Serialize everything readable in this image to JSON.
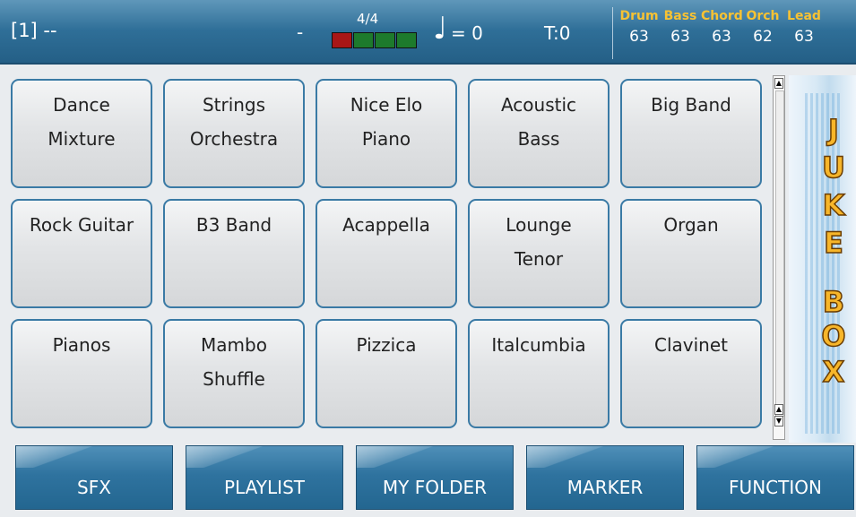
{
  "header": {
    "song": "[1] --",
    "dash": "-",
    "time_signature": "4/4",
    "beats": [
      "#a81616",
      "#1d7a2c",
      "#1d7a2c",
      "#1d7a2c"
    ],
    "tempo_note": "♩",
    "tempo": "= 0",
    "transpose": "T:0",
    "parts": [
      {
        "name": "Drum",
        "value": "63"
      },
      {
        "name": "Bass",
        "value": "63"
      },
      {
        "name": "Chord",
        "value": "63"
      },
      {
        "name": "Orch",
        "value": "62"
      },
      {
        "name": "Lead",
        "value": "63"
      }
    ]
  },
  "styles": [
    "Dance\nMixture",
    "Strings\nOrchestra",
    "Nice Elo\nPiano",
    "Acoustic\nBass",
    "Big Band",
    "Rock Guitar",
    "B3 Band",
    "Acappella",
    "Lounge\nTenor",
    "Organ",
    "Pianos",
    "Mambo\nShuffle",
    "Pizzica",
    "Italcumbia",
    "Clavinet"
  ],
  "jukebox": [
    "J",
    "U",
    "K",
    "E",
    "B",
    "O",
    "X"
  ],
  "bottom_buttons": [
    "SFX",
    "PLAYLIST",
    "MY FOLDER",
    "MARKER",
    "FUNCTION"
  ],
  "colors": {
    "accent": "#2f6f98",
    "part_label": "#f7c233",
    "tile_border": "#3a7aa5"
  }
}
